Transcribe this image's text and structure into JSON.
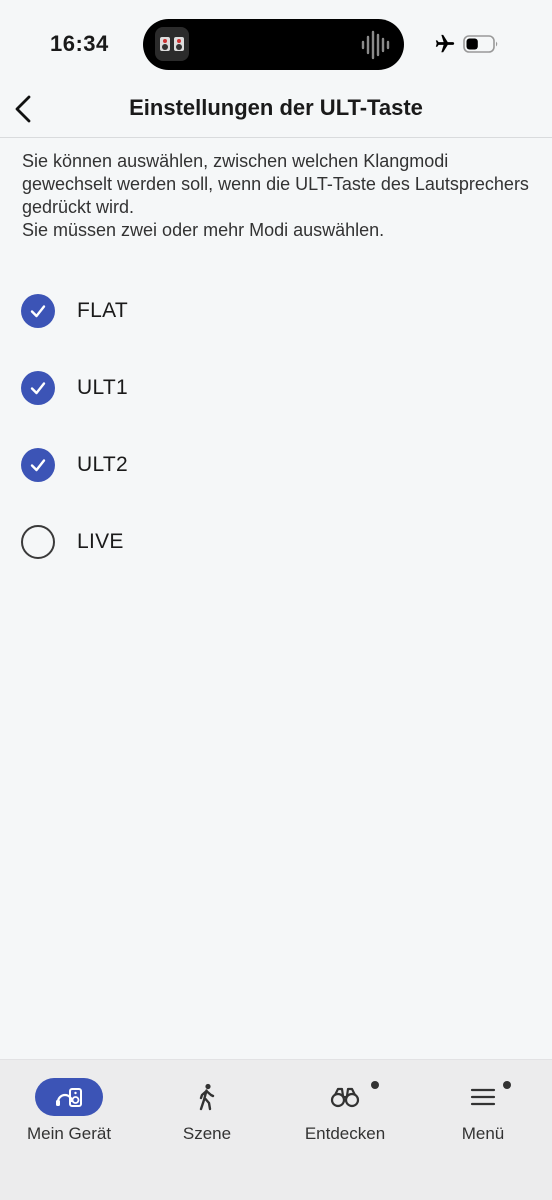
{
  "status_bar": {
    "time": "16:34",
    "island_app_icon": "app-icon",
    "waveform_icon": "audio-waveform-icon",
    "airplane_icon": "airplane-mode-icon",
    "battery_icon": "battery-icon",
    "battery_level": 0.45
  },
  "header": {
    "back_icon": "chevron-left-icon",
    "title": "Einstellungen der ULT-Taste"
  },
  "description": {
    "line1": "Sie können auswählen, zwischen welchen Klangmodi gewechselt werden soll, wenn die ULT-Taste des Lautsprechers gedrückt wird.",
    "line2": "Sie müssen zwei oder mehr Modi auswählen."
  },
  "options": [
    {
      "label": "FLAT",
      "checked": true
    },
    {
      "label": "ULT1",
      "checked": true
    },
    {
      "label": "ULT2",
      "checked": true
    },
    {
      "label": "LIVE",
      "checked": false
    }
  ],
  "bottom_nav": {
    "items": [
      {
        "label": "Mein Gerät",
        "icon": "speaker-device-icon",
        "active": true,
        "badge": false
      },
      {
        "label": "Szene",
        "icon": "walking-person-icon",
        "active": false,
        "badge": false
      },
      {
        "label": "Entdecken",
        "icon": "binoculars-icon",
        "active": false,
        "badge": true
      },
      {
        "label": "Menü",
        "icon": "hamburger-menu-icon",
        "active": false,
        "badge": true
      }
    ]
  },
  "colors": {
    "accent": "#3c54b6",
    "background": "#f5f7f8",
    "nav_background": "#ececed",
    "text": "#1a1a1a"
  }
}
